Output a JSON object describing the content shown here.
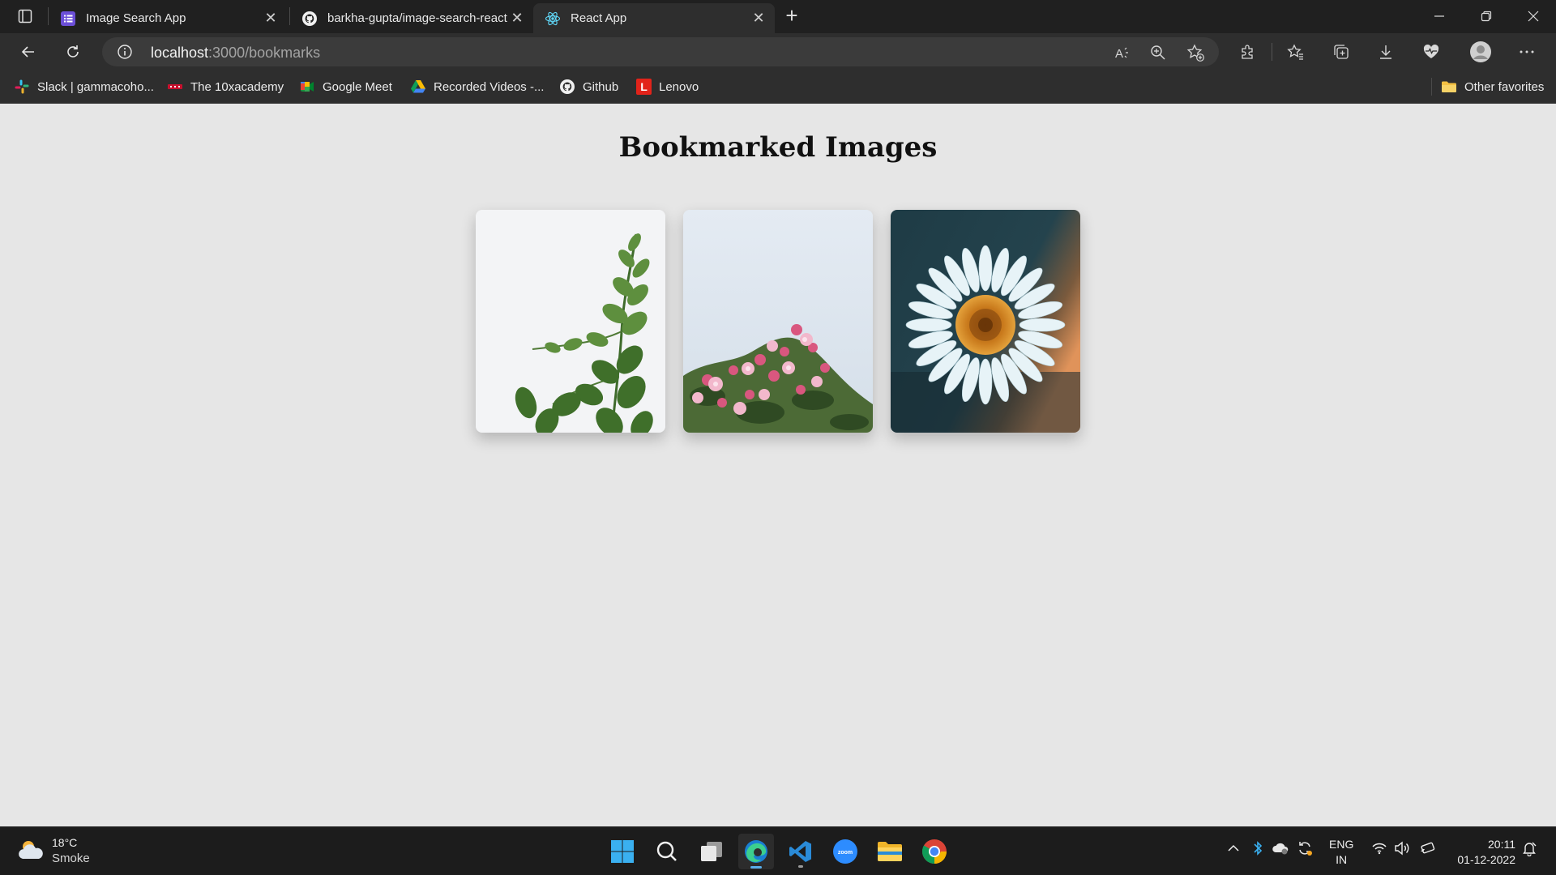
{
  "browser": {
    "tabs": [
      {
        "title": "Image Search App",
        "icon": "list-app-icon",
        "active": false
      },
      {
        "title": "barkha-gupta/image-search-react",
        "icon": "github-icon",
        "active": false
      },
      {
        "title": "React App",
        "icon": "react-icon",
        "active": true
      }
    ],
    "new_tab_label": "+",
    "close_label": "✕",
    "address": {
      "host": "localhost",
      "path": ":3000/bookmarks"
    },
    "favorites": [
      {
        "label": "Slack | gammacoho...",
        "icon": "slack-icon"
      },
      {
        "label": "The 10xacademy",
        "icon": "tenx-icon"
      },
      {
        "label": "Google Meet",
        "icon": "google-meet-icon"
      },
      {
        "label": "Recorded Videos -...",
        "icon": "google-drive-icon"
      },
      {
        "label": "Github",
        "icon": "github-icon"
      },
      {
        "label": "Lenovo",
        "icon": "lenovo-icon",
        "icon_text": "L"
      }
    ],
    "other_favorites": "Other favorites"
  },
  "page": {
    "title": "Bookmarked Images",
    "images": [
      {
        "subject": "eucalyptus-branch"
      },
      {
        "subject": "pink-blossoms"
      },
      {
        "subject": "white-daisy"
      }
    ]
  },
  "taskbar": {
    "weather": {
      "temp": "18°C",
      "condition": "Smoke"
    },
    "lang_top": "ENG",
    "lang_bottom": "IN",
    "time": "20:11",
    "date": "01-12-2022",
    "zoom_text": "zoom"
  },
  "colors": {
    "accent_blue": "#5aaee8",
    "page_bg": "#e6e6e6",
    "chrome_dark": "#202020"
  }
}
